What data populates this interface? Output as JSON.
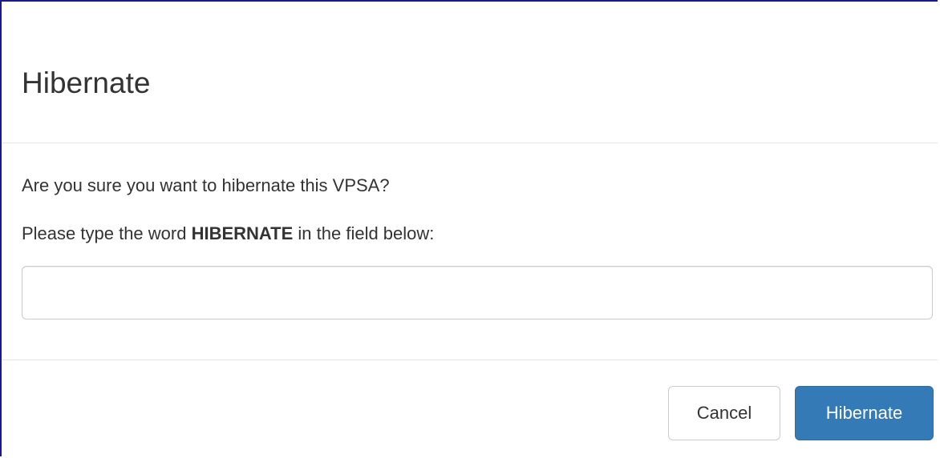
{
  "dialog": {
    "title": "Hibernate",
    "question": "Are you sure you want to hibernate this VPSA?",
    "instruction_prefix": "Please type the word ",
    "instruction_keyword": "HIBERNATE",
    "instruction_suffix": " in the field below:",
    "input_value": "",
    "input_placeholder": ""
  },
  "footer": {
    "cancel_label": "Cancel",
    "confirm_label": "Hibernate"
  },
  "colors": {
    "primary_button": "#337ab7",
    "frame_border": "#1a1a8c",
    "divider": "#e5e5e5"
  }
}
